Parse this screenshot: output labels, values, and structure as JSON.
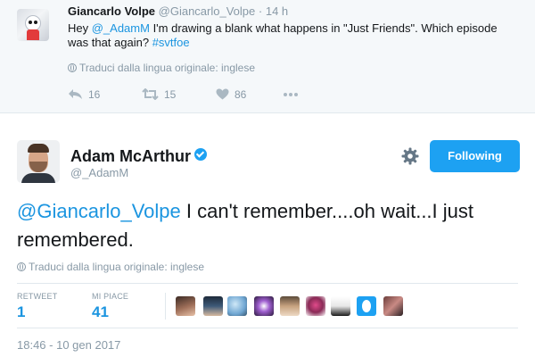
{
  "parent_tweet": {
    "name": "Giancarlo Volpe",
    "handle": "@Giancarlo_Volpe",
    "separator": "·",
    "time": "14 h",
    "text_prefix": "Hey ",
    "mention": "@_AdamM",
    "text_middle": " I'm drawing a blank what happens in \"Just Friends\".  Which episode was that again? ",
    "hashtag": "#svtfoe",
    "translate": "Traduci dalla lingua originale: inglese",
    "actions": {
      "reply_count": "16",
      "retweet_count": "15",
      "like_count": "86"
    }
  },
  "main_tweet": {
    "name": "Adam McArthur",
    "handle": "@_AdamM",
    "follow_label": "Following",
    "mention": "@Giancarlo_Volpe",
    "text": " I can't remember....oh wait...I just remembered.",
    "translate": "Traduci dalla lingua originale: inglese",
    "stats": {
      "retweet_label": "RETWEET",
      "retweet_count": "1",
      "likes_label": "MI PIACE",
      "likes_count": "41"
    },
    "date": "18:46 - 10 gen 2017"
  },
  "colors": {
    "accent": "#1da1f2",
    "link": "#1b95e0",
    "muted": "#8899a6",
    "parent_bg": "#f5f8fa"
  },
  "icons": [
    "reply-icon",
    "retweet-icon",
    "heart-icon",
    "more-icon",
    "globe-icon",
    "verified-icon",
    "gear-icon"
  ]
}
